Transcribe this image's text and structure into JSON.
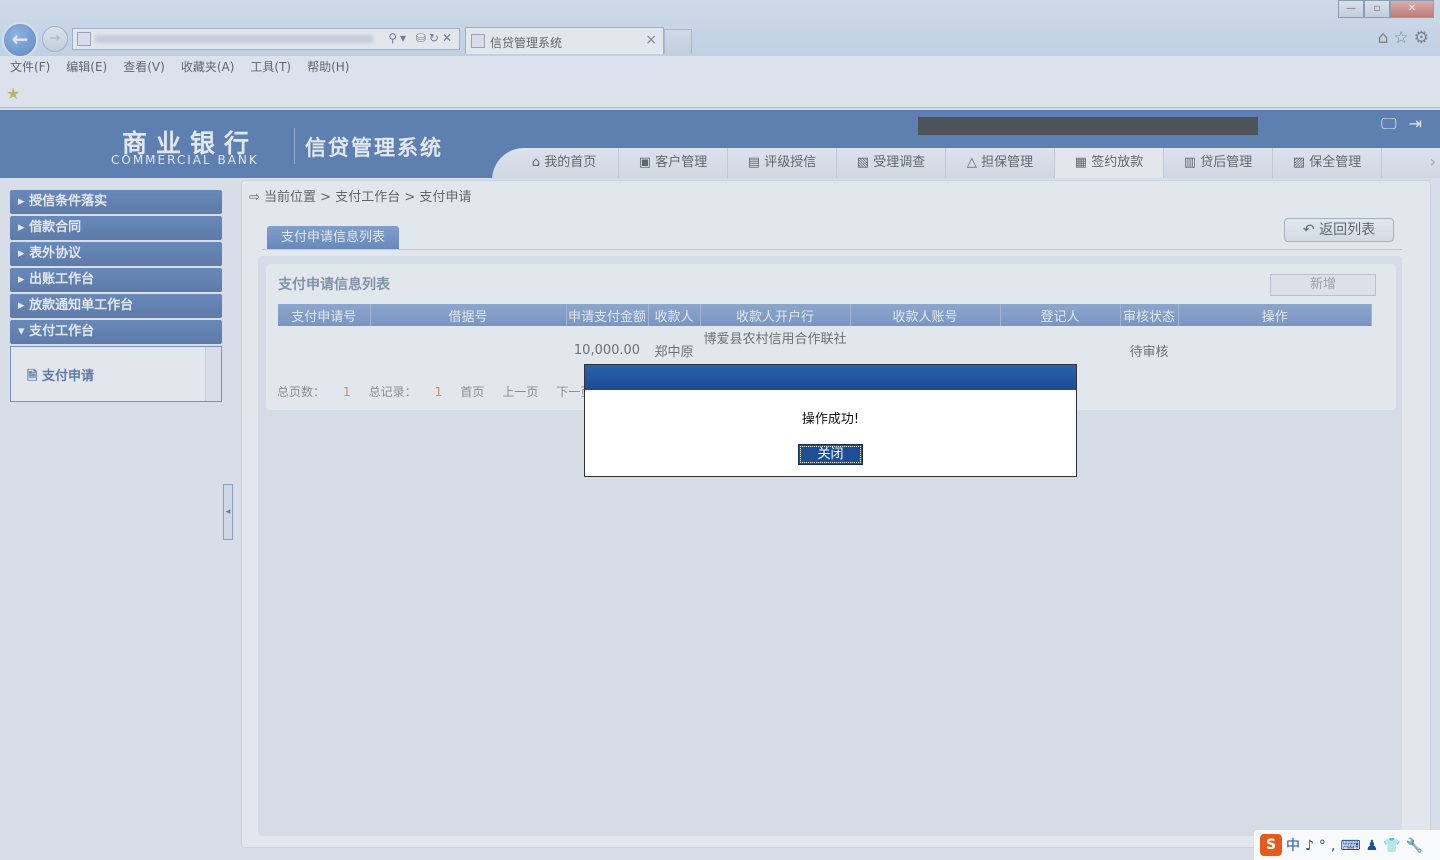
{
  "browser": {
    "tab_title": "信贷管理系统",
    "tab_close": "×",
    "back": "←",
    "forward": "→",
    "window": {
      "minimize": "—",
      "maximize": "▫",
      "close": "✕"
    },
    "addr_icons": "⚲▾ ⛁↻✕",
    "tool_icons": "⌂☆⚙",
    "menu": [
      "文件(F)",
      "编辑(E)",
      "查看(V)",
      "收藏夹(A)",
      "工具(T)",
      "帮助(H)"
    ],
    "fav_icon": "star-icon"
  },
  "header": {
    "logo_cn": "商业银行",
    "logo_en": "COMMERCIAL BANK",
    "system_title": "信贷管理系统",
    "icons": "🖵⇥",
    "nav": [
      {
        "icon": "⌂",
        "label": "我的首页"
      },
      {
        "icon": "▣",
        "label": "客户管理"
      },
      {
        "icon": "▤",
        "label": "评级授信"
      },
      {
        "icon": "▧",
        "label": "受理调查"
      },
      {
        "icon": "△",
        "label": "担保管理"
      },
      {
        "icon": "▦",
        "label": "签约放款"
      },
      {
        "icon": "▥",
        "label": "贷后管理"
      },
      {
        "icon": "▨",
        "label": "保全管理"
      }
    ],
    "nav_more": "›",
    "active_index": 5
  },
  "sidebar": {
    "items": [
      "授信条件落实",
      "借款合同",
      "表外协议",
      "出账工作台",
      "放款通知单工作台",
      "支付工作台"
    ],
    "expanded_index": 5,
    "sub_items": [
      "支付申请"
    ],
    "collapse": "◂"
  },
  "breadcrumb": "当前位置 > 支付工作台 > 支付申请",
  "subtab": "支付申请信息列表",
  "back_list_button": "返回列表",
  "panel": {
    "title": "支付申请信息列表",
    "add_button": "新增",
    "columns": [
      "支付申请号",
      "借据号",
      "申请支付金额",
      "收款人",
      "收款人开户行",
      "收款人账号",
      "登记人",
      "审核状态",
      "操作"
    ],
    "rows": [
      {
        "amount": "10,000.00",
        "payee": "郑中原",
        "bank": "博爱县农村信用合作联社",
        "status": "待审核"
      }
    ],
    "pager": {
      "pages_label": "总页数：",
      "pages": "1",
      "records_label": "总记录：",
      "records": "1",
      "first": "首页",
      "prev": "上一页",
      "next": "下一页"
    }
  },
  "dialog": {
    "message": "操作成功!",
    "close_button": "关闭"
  },
  "tray": {
    "ime": "S",
    "text": "中♪°,⌨♟👕🔧"
  }
}
